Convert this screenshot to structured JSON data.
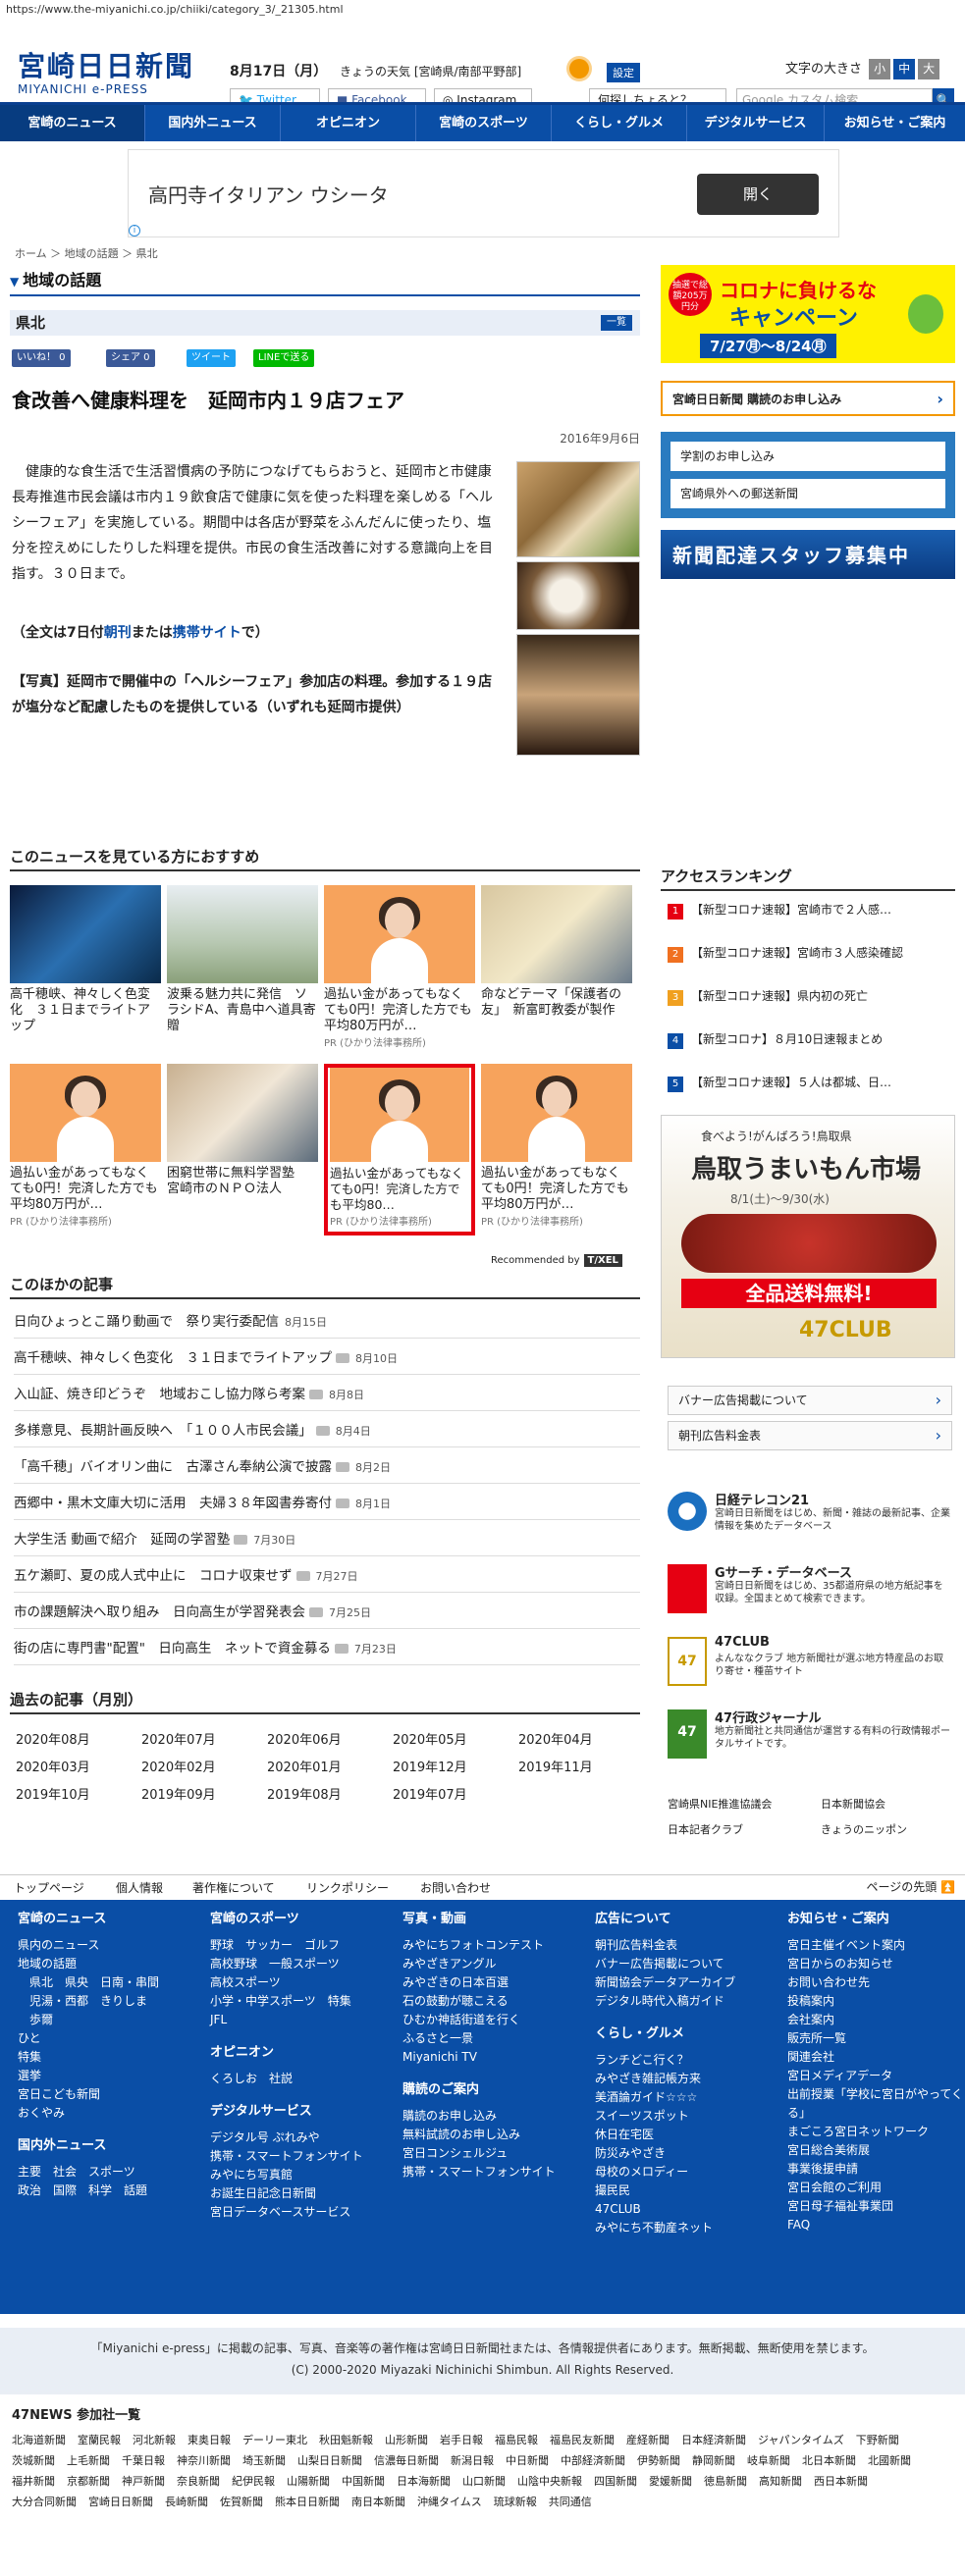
{
  "url": "https://www.the-miyanichi.co.jp/chiiki/category_3/_21305.html",
  "logo": {
    "jp": "宮崎日日新聞",
    "en": "MIYANICHI e-PRESS"
  },
  "header": {
    "date": "8月17日（月）",
    "weather": "きょうの天気 [宮崎県/南部平野部]",
    "settings": "設定",
    "font_size_label": "文字の大きさ",
    "font_sizes": [
      "小",
      "中",
      "大"
    ],
    "twitter": "Twitter",
    "facebook": "Facebook",
    "instagram": "Instagram",
    "ask": "何探しちょると？",
    "search_placeholder": "Google カスタム検索",
    "search_btn": "🔍"
  },
  "nav": [
    "宮崎のニュース",
    "国内外ニュース",
    "オピニオン",
    "宮崎のスポーツ",
    "くらし・グルメ",
    "デジタルサービス",
    "お知らせ・ご案内"
  ],
  "ad": {
    "text": "高円寺イタリアン ウシータ",
    "button": "開く",
    "info": "i"
  },
  "breadcrumb": "ホーム ＞ 地域の話題 ＞ 県北",
  "section": "地域の話題",
  "subsection": "県北",
  "list_btn": "一覧",
  "social": {
    "like": "いいね！ 0",
    "share": "シェア 0",
    "tweet": "ツイート",
    "line": "LINEで送る"
  },
  "article": {
    "title": "食改善へ健康料理を　延岡市内１９店フェア",
    "date": "2016年9月6日",
    "body": "健康的な食生活で生活習慣病の予防につなげてもらおうと、延岡市と市健康長寿推進市民会議は市内１９飲食店で健康に気を使った料理を楽しめる「ヘルシーフェア」を実施している。期間中は各店が野菜をふんだんに使ったり、塩分を控えめにしたりした料理を提供。市民の食生活改善に対する意識向上を目指す。３０日まで。",
    "full_prefix": "（全文は7日付",
    "full_morning": "朝刊",
    "full_mid": "または",
    "full_mobile": "携帯サイト",
    "full_suffix": "で）",
    "caption": "【写真】延岡市で開催中の「ヘルシーフェア」参加店の料理。参加する１９店が塩分など配慮したものを提供している（いずれも延岡市提供）"
  },
  "recommend": {
    "title": "このニュースを見ている方におすすめ",
    "items": [
      {
        "text": "高千穂峡、神々しく色変化　３１日までライトアップ",
        "pr": ""
      },
      {
        "text": "波乗る魅力共に発信　ソラシドA、青島中へ道具寄贈",
        "pr": ""
      },
      {
        "text": "過払い金があってもなくても0円！完済した方でも平均80万円が…",
        "pr": "PR (ひかり法律事務所)"
      },
      {
        "text": "命などテーマ「保護者の友」　新富町教委が製作",
        "pr": ""
      },
      {
        "text": "過払い金があってもなくても0円！完済した方でも平均80万円が…",
        "pr": "PR (ひかり法律事務所)"
      },
      {
        "text": "困窮世帯に無料学習塾　宮崎市のＮＰＯ法人",
        "pr": ""
      },
      {
        "text": "過払い金があってもなくても0円！完済した方でも平均80…",
        "pr": "PR (ひかり法律事務所)"
      },
      {
        "text": "過払い金があってもなくても0円！完済した方でも平均80万円が…",
        "pr": "PR (ひかり法律事務所)"
      }
    ],
    "by": "Recommended by",
    "brand": "T/XEL"
  },
  "other": {
    "title": "このほかの記事",
    "items": [
      {
        "t": "日向ひょっとこ踊り動画で　祭り実行委配信",
        "d": "8月15日",
        "cam": false
      },
      {
        "t": "高千穂峡、神々しく色変化　３１日までライトアップ",
        "d": "8月10日",
        "cam": true
      },
      {
        "t": "入山証、焼き印どうぞ　地域おこし協力隊ら考案",
        "d": "8月8日",
        "cam": true
      },
      {
        "t": "多様意見、長期計画反映へ　「１００人市民会議」",
        "d": "8月4日",
        "cam": true
      },
      {
        "t": "「高千穂」バイオリン曲に　古澤さん奉納公演で披露",
        "d": "8月2日",
        "cam": true
      },
      {
        "t": "西郷中・黒木文庫大切に活用　夫婦３８年図書券寄付",
        "d": "8月1日",
        "cam": true
      },
      {
        "t": "大学生活 動画で紹介　延岡の学習塾",
        "d": "7月30日",
        "cam": true
      },
      {
        "t": "五ケ瀬町、夏の成人式中止に　コロナ収束せず",
        "d": "7月27日",
        "cam": true
      },
      {
        "t": "市の課題解決へ取り組み　日向高生が学習発表会",
        "d": "7月25日",
        "cam": true
      },
      {
        "t": "街の店に専門書\"配置\"　日向高生　ネットで資金募る",
        "d": "7月23日",
        "cam": true
      }
    ]
  },
  "past": {
    "title": "過去の記事（月別）",
    "months": [
      "2020年08月",
      "2020年07月",
      "2020年06月",
      "2020年05月",
      "2020年04月",
      "2020年03月",
      "2020年02月",
      "2020年01月",
      "2019年12月",
      "2019年11月",
      "2019年10月",
      "2019年09月",
      "2019年08月",
      "2019年07月"
    ]
  },
  "side": {
    "banner1_l1": "コロナに負けるな",
    "banner1_l2": "キャンペーン",
    "banner1_date": "7/27㊊～8/24㊊",
    "banner1_tag": "抽選で総額205万円分",
    "subscribe": "宮崎日日新聞 購読のお申し込み",
    "study": "学割のお申し込み",
    "mail": "宮崎県外への郵送新聞",
    "staff": "新聞配達スタッフ募集中",
    "ranking_title": "アクセスランキング",
    "ranking": [
      "【新型コロナ速報】宮崎市で２人感…",
      "【新型コロナ速報】宮崎市３人感染確認",
      "【新型コロナ速報】県内初の死亡",
      "【新型コロナ】８月10日速報まとめ",
      "【新型コロナ速報】５人は都城、日…"
    ],
    "ad2_l1": "食べよう!がんばろう!鳥取県",
    "ad2_l2": "鳥取うまいもん市場",
    "ad2_l3": "全品送料無料!",
    "ad2_date": "8/1(土)～9/30(水)",
    "ad2_brand": "47CLUB",
    "banner_ad": "バナー広告掲載について",
    "morning_ad": "朝刊広告料金表",
    "services": [
      {
        "n": "日経テレコン21",
        "d": "宮崎日日新聞をはじめ、新聞・雑誌の最新記事、企業情報を集めたデータベース"
      },
      {
        "n": "Gサーチ・データベース",
        "d": "宮崎日日新聞をはじめ、35都道府県の地方紙記事を収録。全国まとめて検索できます。"
      },
      {
        "n": "47CLUB",
        "d": "よんななクラブ 地方新聞社が選ぶ地方特産品のお取り寄せ・種苗サイト"
      },
      {
        "n": "47行政ジャーナル",
        "d": "地方新聞社と共同通信が運営する有料の行政情報ポータルサイトです。"
      }
    ],
    "links": [
      "宮崎県NIE推進協議会",
      "日本新聞協会",
      "日本記者クラブ",
      "きょうのニッポン"
    ]
  },
  "footer_links": [
    "トップページ",
    "個人情報",
    "著作権について",
    "リンクポリシー",
    "お問い合わせ"
  ],
  "pagetop": "ページの先頭",
  "fcols": [
    {
      "h": "宮崎のニュース",
      "items": [
        "県内のニュース",
        "地域の話題",
        "　県北　県央　日南・串間",
        "　児湯・西都　きりしま",
        "　歩爾",
        "ひと",
        "特集",
        "選挙",
        "宮日こども新聞",
        "おくやみ"
      ],
      "h2": "国内外ニュース",
      "items2": [
        "主要　社会　スポーツ",
        "政治　国際　科学　話題"
      ]
    },
    {
      "h": "宮崎のスポーツ",
      "items": [
        "野球　サッカー　ゴルフ",
        "高校野球　一般スポーツ",
        "高校スポーツ",
        "小学・中学スポーツ　特集",
        "JFL"
      ],
      "h2": "オピニオン",
      "items2": [
        "くろしお　社説"
      ],
      "h3": "デジタルサービス",
      "items3": [
        "デジタル号 ぷれみや",
        "携帯・スマートフォンサイト",
        "みやにち写真館",
        "お誕生日記念日新聞",
        "宮日データベースサービス"
      ]
    },
    {
      "h": "写真・動画",
      "items": [
        "みやにちフォトコンテスト",
        "みやざきアングル",
        "みやざきの日本百選",
        "石の鼓動が聴こえる",
        "ひむか神話街道を行く",
        "ふるさと一景",
        "Miyanichi TV"
      ],
      "h2": "購読のご案内",
      "items2": [
        "購読のお申し込み",
        "無料試読のお申し込み",
        "宮日コンシェルジュ",
        "携帯・スマートフォンサイト"
      ]
    },
    {
      "h": "広告について",
      "items": [
        "朝刊広告料金表",
        "バナー広告掲載について",
        "新聞協会データアーカイブ",
        "デジタル時代入稿ガイド"
      ],
      "h2": "くらし・グルメ",
      "items2": [
        "ランチどこ行く？",
        "みやざき雑記帳方来",
        "美酒論ガイド☆☆☆",
        "スイーツスポット",
        "休日在宅医",
        "防災みやざき",
        "母校のメロディー",
        "撮民民",
        "47CLUB",
        "みやにち不動産ネット"
      ]
    },
    {
      "h": "お知らせ・ご案内",
      "items": [
        "宮日主催イベント案内",
        "宮日からのお知らせ",
        "お問い合わせ先",
        "投稿案内",
        "会社案内",
        "販売所一覧",
        "関連会社",
        "宮日メディアデータ",
        "出前授業「学校に宮日がやってくる」",
        "まごころ宮日ネットワーク",
        "宮日総合美術展",
        "事業後援申請",
        "宮日会館のご利用",
        "宮日母子福祉事業団",
        "FAQ"
      ]
    }
  ],
  "copyright1": "「Miyanichi e-press」に掲載の記事、写真、音楽等の著作権は宮崎日日新聞社または、各情報提供者にあります。無断掲載、無断使用を禁じます。",
  "copyright2": "(C) 2000-2020 Miyazaki Nichinichi Shimbun. All Rights Reserved.",
  "n47_title": "47NEWS 参加社一覧",
  "n47": [
    "北海道新聞",
    "室蘭民報",
    "河北新報",
    "東奥日報",
    "デーリー東北",
    "秋田魁新報",
    "山形新聞",
    "岩手日報",
    "福島民報",
    "福島民友新聞",
    "産経新聞",
    "日本経済新聞",
    "ジャパンタイムズ",
    "下野新聞",
    "茨城新聞",
    "上毛新聞",
    "千葉日報",
    "神奈川新聞",
    "埼玉新聞",
    "山梨日日新聞",
    "信濃毎日新聞",
    "新潟日報",
    "中日新聞",
    "中部経済新聞",
    "伊勢新聞",
    "静岡新聞",
    "岐阜新聞",
    "北日本新聞",
    "北國新聞",
    "福井新聞",
    "京都新聞",
    "神戸新聞",
    "奈良新聞",
    "紀伊民報",
    "山陽新聞",
    "中国新聞",
    "日本海新聞",
    "山口新聞",
    "山陰中央新報",
    "四国新聞",
    "愛媛新聞",
    "徳島新聞",
    "高知新聞",
    "西日本新聞",
    "大分合同新聞",
    "宮崎日日新聞",
    "長崎新聞",
    "佐賀新聞",
    "熊本日日新聞",
    "南日本新聞",
    "沖縄タイムス",
    "琉球新報",
    "共同通信"
  ]
}
